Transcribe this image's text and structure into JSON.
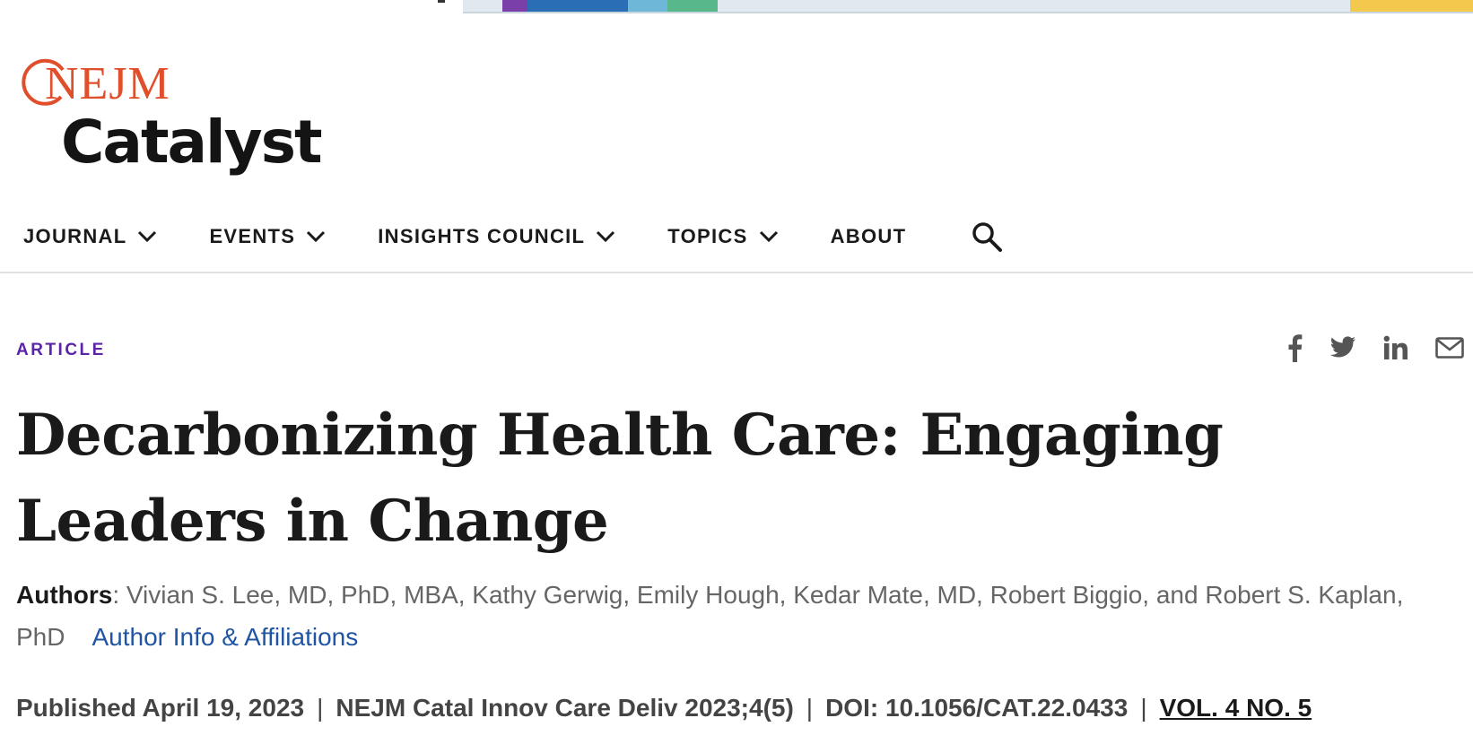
{
  "logo": {
    "brand": "NEJM",
    "product": "Catalyst",
    "accent_color": "#e04e2b"
  },
  "nav": {
    "items": [
      {
        "label": "JOURNAL",
        "icon": "chevron-down-icon"
      },
      {
        "label": "EVENTS",
        "icon": "chevron-down-icon"
      },
      {
        "label": "INSIGHTS COUNCIL",
        "icon": "chevron-down-icon"
      },
      {
        "label": "TOPICS",
        "icon": "chevron-down-icon"
      },
      {
        "label": "ABOUT"
      }
    ],
    "search_icon": "search-icon"
  },
  "article": {
    "kicker": "ARTICLE",
    "kicker_color": "#5b23a6",
    "title": "Decarbonizing Health Care: Engaging Leaders in Change",
    "authors_label": "Authors",
    "authors": ": Vivian S. Lee, MD, PhD, MBA, Kathy Gerwig, Emily Hough, Kedar Mate, MD, Robert Biggio, and Robert S. Kaplan, PhD",
    "author_info_link": "Author Info & Affiliations",
    "link_color": "#1f55a3",
    "published": "Published April 19, 2023",
    "citation": "NEJM Catal Innov Care Deliv 2023;4(5)",
    "doi": "DOI: 10.1056/CAT.22.0433",
    "issue": "VOL. 4 NO. 5",
    "separator": "|"
  },
  "share": {
    "icons": [
      "facebook-icon",
      "twitter-icon",
      "linkedin-icon",
      "email-icon"
    ]
  }
}
